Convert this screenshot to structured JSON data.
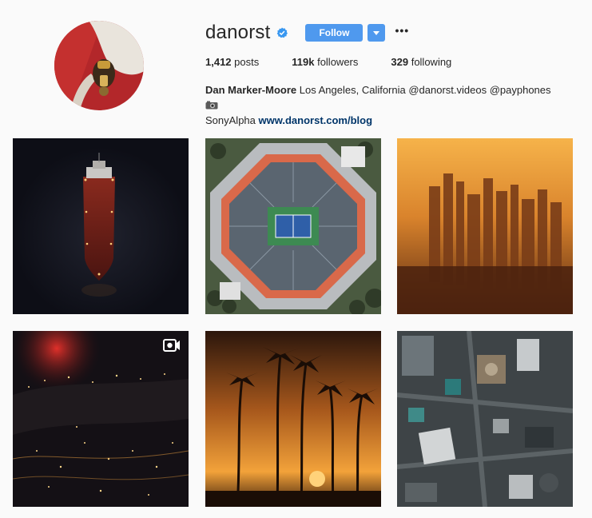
{
  "profile": {
    "username": "danorst",
    "verified": true,
    "follow_label": "Follow",
    "dropdown_icon": "caret-down-icon",
    "more_label": "•••",
    "avatar_icon": "payphone-avatar"
  },
  "stats": {
    "posts_count": "1,412",
    "posts_label": "posts",
    "followers_count": "119k",
    "followers_label": "followers",
    "following_count": "329",
    "following_label": "following"
  },
  "bio": {
    "name": "Dan Marker-Moore",
    "text": "Los Angeles, California @danorst.videos @payphones",
    "text2": "SonyAlpha",
    "link": "www.danorst.com/blog"
  },
  "posts": [
    {
      "subject": "aerial-ship-at-night"
    },
    {
      "subject": "tennis-stadium-aerial"
    },
    {
      "subject": "city-sunset-haze"
    },
    {
      "subject": "city-lights-at-night",
      "video": true
    },
    {
      "subject": "palm-trees-sunset"
    },
    {
      "subject": "downtown-aerial"
    }
  ],
  "colors": {
    "accent": "#4f99ee",
    "link": "#003569",
    "verified": "#3897f0"
  }
}
